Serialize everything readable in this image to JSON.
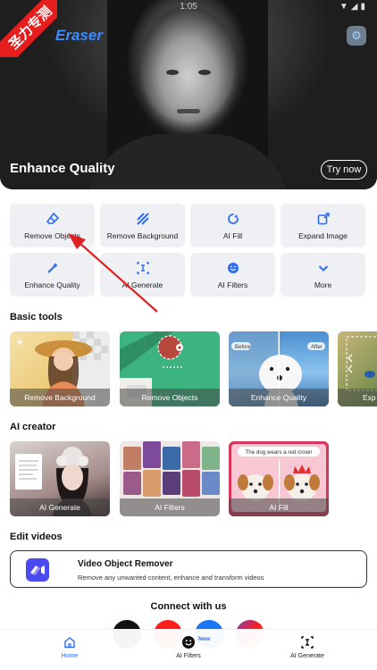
{
  "status_bar": {
    "time": "1:05",
    "icons": "▼◢▮"
  },
  "header": {
    "app_title": "Eraser",
    "watermark_text": "圣力专测"
  },
  "hero": {
    "title": "Enhance Quality",
    "try_label": "Try now"
  },
  "tools": [
    {
      "label": "Remove Objects",
      "icon": "eraser-icon"
    },
    {
      "label": "Remove Background",
      "icon": "stripes-icon"
    },
    {
      "label": "AI Fill",
      "icon": "refresh-icon"
    },
    {
      "label": "Expand Image",
      "icon": "expand-icon"
    },
    {
      "label": "Enhance Quality",
      "icon": "magic-wand-icon"
    },
    {
      "label": "AI Generate",
      "icon": "text-cursor-icon"
    },
    {
      "label": "AI Filters",
      "icon": "smile-icon"
    },
    {
      "label": "More",
      "icon": "chevron-down-icon"
    }
  ],
  "basic_tools": {
    "title": "Basic tools",
    "cards": [
      "Remove Background",
      "Remove Objects",
      "Enhance Quality",
      "Exp"
    ],
    "before_label": "Before",
    "after_label": "After"
  },
  "ai_creator": {
    "title": "AI creator",
    "cards": [
      "AI Generate",
      "AI Filters",
      "AI Fill"
    ],
    "fill_caption": "The dog wears a red crown"
  },
  "edit_videos": {
    "title": "Edit videos",
    "video_title": "Video Object Remover",
    "video_subtitle": "Remove any unwanted content, enhance and transform videos"
  },
  "connect": {
    "title": "Connect with us"
  },
  "bottom_nav": {
    "home": "Home",
    "filters": "AI Filters",
    "generate": "AI Generate",
    "new_badge": "New"
  },
  "colors": {
    "accent": "#2f6df6",
    "watermark": "#e51d1d",
    "annotation_arrow": "#e02020"
  }
}
